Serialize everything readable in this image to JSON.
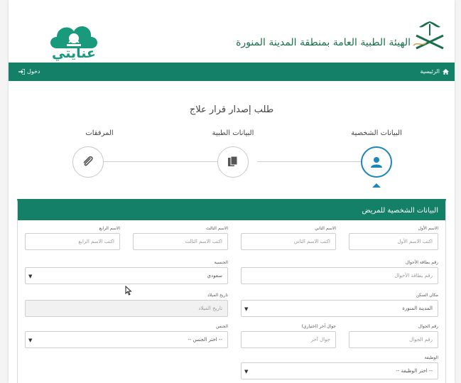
{
  "header": {
    "org_name": "الهيئة الطبية العامة بمنطقة المدينة المنورة",
    "app_name": "عنايتي",
    "brand_green": "#138067",
    "logo_teal": "#1a9a7c",
    "active_blue": "#1d86b8"
  },
  "navbar": {
    "home_label": "الرئيسية",
    "home_icon": "home-icon",
    "login_label": "دخول",
    "login_icon": "sign-in-icon"
  },
  "page": {
    "title": "طلب إصدار قرار علاج"
  },
  "steps": [
    {
      "label": "البيانات الشخصية",
      "icon": "user-icon",
      "active": true
    },
    {
      "label": "البيانات الطبية",
      "icon": "documents-icon",
      "active": false
    },
    {
      "label": "المرفقات",
      "icon": "paperclip-icon",
      "active": false
    }
  ],
  "panel": {
    "title": "البيانات الشخصية للمريض"
  },
  "form": {
    "first_name": {
      "label": "الاسم الأول",
      "placeholder": "اكتب الاسم الأول"
    },
    "second_name": {
      "label": "الاسم الثاني",
      "placeholder": "اكتب الاسم الثاني"
    },
    "third_name": {
      "label": "الاسم الثالث",
      "placeholder": "اكتب الاسم الثالث"
    },
    "fourth_name": {
      "label": "الاسم الرابع",
      "placeholder": "اكتب الاسم الرابع"
    },
    "civil_id": {
      "label": "رقم بطاقة الأحوال",
      "placeholder": "رقم بطاقة الأحوال"
    },
    "nationality": {
      "label": "الجنسية",
      "value": "سعودي"
    },
    "residence": {
      "label": "مكان السكن",
      "value": "المدينة المنورة"
    },
    "birth_date": {
      "label": "تاريخ الميلاد",
      "placeholder": "تاريخ الميلاد"
    },
    "mobile": {
      "label": "رقم الجوال",
      "placeholder": "رقم الجوال"
    },
    "alt_mobile": {
      "label": "جوال آخر (اختياري)",
      "placeholder": "جوال آخر"
    },
    "gender": {
      "label": "الجنس",
      "value": "-- اختر الجنس --"
    },
    "job": {
      "label": "الوظيفة",
      "value": "-- اختر الوظيفة --"
    }
  }
}
